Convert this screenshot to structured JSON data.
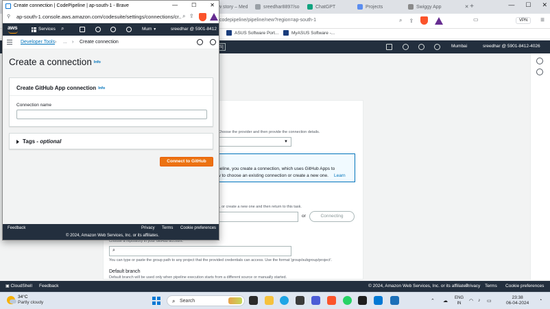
{
  "background_browser": {
    "tabs": [
      {
        "label": "w story – Med"
      },
      {
        "label": "sreedhar8897/so"
      },
      {
        "label": "ChatGPT"
      },
      {
        "label": "Projects"
      },
      {
        "label": "Swiggy App"
      }
    ],
    "url": "/codepipeline/pipeline/new?region=ap-south-1",
    "vpn_label": "VPN",
    "bookmarks": [
      "ASUS Software Port...",
      "MyASUS Software -..."
    ],
    "aws_nav": {
      "region": "Mumbai",
      "account": "sreedhar @ 5901-8412-4026",
      "shortcut": "S]"
    },
    "content": {
      "provider_hint": "Choose the provider and then provide the connection details.",
      "info_line1": "peline, you create a connection, which uses GitHub Apps to",
      "info_line2": "w to choose an existing connection or create a new one.",
      "learn_link": "Learn",
      "create_hint": "d, or create a new one and then return to this task.",
      "or_text": "or",
      "connecting_label": "Connecting",
      "repo_hint": "Choose a repository in your GitHub account.",
      "group_path_hint": "You can type or paste the group path to any project that the provided credentials can access. Use the format 'group/subgroup/project'.",
      "default_branch_label": "Default branch",
      "default_branch_hint": "Default branch will be used only when pipeline execution starts from a different source or manually started."
    },
    "footer": {
      "cloudshell": "CloudShell",
      "feedback": "Feedback",
      "copyright": "© 2024, Amazon Web Services, Inc. or its affiliates.",
      "privacy": "Privacy",
      "terms": "Terms",
      "cookies": "Cookie preferences"
    }
  },
  "popup": {
    "window_title": "Create connection | CodePipeline | ap-south-1 - Brave",
    "url": "ap-south-1.console.aws.amazon.com/codesuite/settings/connections/cr...",
    "aws_nav": {
      "logo": "aws",
      "services": "Services",
      "region": "Mum",
      "account": "sreedhar @ 5901-8412"
    },
    "breadcrumb": {
      "root": "Developer Tools",
      "ellipsis": "...",
      "current": "Create connection"
    },
    "page_title": "Create a connection",
    "info": "Info",
    "section_title": "Create GitHub App connection",
    "connection_name_label": "Connection name",
    "connection_name_value": "",
    "tags_label": "Tags",
    "tags_optional": "optional",
    "connect_button": "Connect to GitHub",
    "footer": {
      "feedback": "Feedback",
      "privacy": "Privacy",
      "terms": "Terms",
      "cookies": "Cookie preferences",
      "copyright": "© 2024, Amazon Web Services, Inc. or its affiliates."
    }
  },
  "taskbar": {
    "temperature": "34°C",
    "weather": "Partly cloudy",
    "search_placeholder": "Search",
    "lang_top": "ENG",
    "lang_bottom": "IN",
    "time": "23:38",
    "date": "06-04-2024"
  },
  "colors": {
    "aws_nav": "#232f3e",
    "aws_orange": "#ec7211",
    "link_blue": "#0073bb",
    "console_bg": "#f2f3f3"
  }
}
